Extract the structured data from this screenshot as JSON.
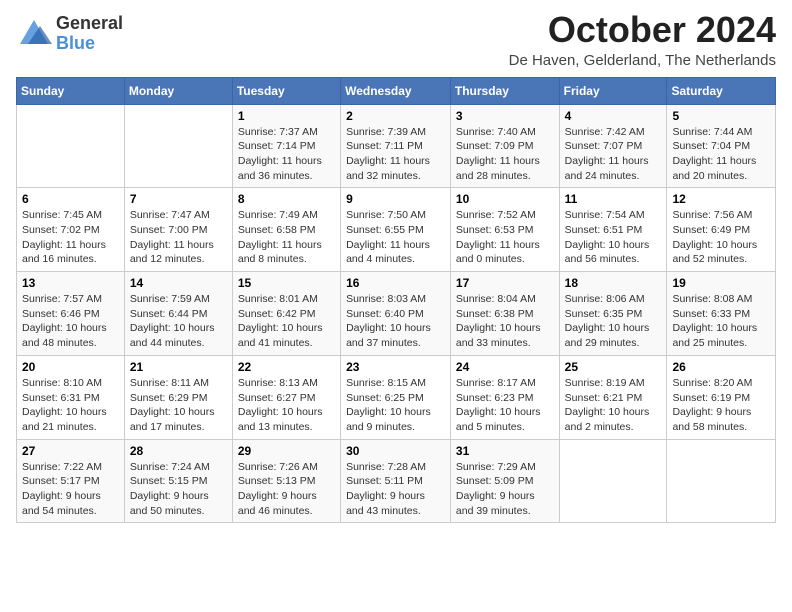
{
  "header": {
    "logo_line1": "General",
    "logo_line2": "Blue",
    "month_title": "October 2024",
    "location": "De Haven, Gelderland, The Netherlands"
  },
  "days_of_week": [
    "Sunday",
    "Monday",
    "Tuesday",
    "Wednesday",
    "Thursday",
    "Friday",
    "Saturday"
  ],
  "weeks": [
    [
      {
        "day": "",
        "info": ""
      },
      {
        "day": "",
        "info": ""
      },
      {
        "day": "1",
        "info": "Sunrise: 7:37 AM\nSunset: 7:14 PM\nDaylight: 11 hours and 36 minutes."
      },
      {
        "day": "2",
        "info": "Sunrise: 7:39 AM\nSunset: 7:11 PM\nDaylight: 11 hours and 32 minutes."
      },
      {
        "day": "3",
        "info": "Sunrise: 7:40 AM\nSunset: 7:09 PM\nDaylight: 11 hours and 28 minutes."
      },
      {
        "day": "4",
        "info": "Sunrise: 7:42 AM\nSunset: 7:07 PM\nDaylight: 11 hours and 24 minutes."
      },
      {
        "day": "5",
        "info": "Sunrise: 7:44 AM\nSunset: 7:04 PM\nDaylight: 11 hours and 20 minutes."
      }
    ],
    [
      {
        "day": "6",
        "info": "Sunrise: 7:45 AM\nSunset: 7:02 PM\nDaylight: 11 hours and 16 minutes."
      },
      {
        "day": "7",
        "info": "Sunrise: 7:47 AM\nSunset: 7:00 PM\nDaylight: 11 hours and 12 minutes."
      },
      {
        "day": "8",
        "info": "Sunrise: 7:49 AM\nSunset: 6:58 PM\nDaylight: 11 hours and 8 minutes."
      },
      {
        "day": "9",
        "info": "Sunrise: 7:50 AM\nSunset: 6:55 PM\nDaylight: 11 hours and 4 minutes."
      },
      {
        "day": "10",
        "info": "Sunrise: 7:52 AM\nSunset: 6:53 PM\nDaylight: 11 hours and 0 minutes."
      },
      {
        "day": "11",
        "info": "Sunrise: 7:54 AM\nSunset: 6:51 PM\nDaylight: 10 hours and 56 minutes."
      },
      {
        "day": "12",
        "info": "Sunrise: 7:56 AM\nSunset: 6:49 PM\nDaylight: 10 hours and 52 minutes."
      }
    ],
    [
      {
        "day": "13",
        "info": "Sunrise: 7:57 AM\nSunset: 6:46 PM\nDaylight: 10 hours and 48 minutes."
      },
      {
        "day": "14",
        "info": "Sunrise: 7:59 AM\nSunset: 6:44 PM\nDaylight: 10 hours and 44 minutes."
      },
      {
        "day": "15",
        "info": "Sunrise: 8:01 AM\nSunset: 6:42 PM\nDaylight: 10 hours and 41 minutes."
      },
      {
        "day": "16",
        "info": "Sunrise: 8:03 AM\nSunset: 6:40 PM\nDaylight: 10 hours and 37 minutes."
      },
      {
        "day": "17",
        "info": "Sunrise: 8:04 AM\nSunset: 6:38 PM\nDaylight: 10 hours and 33 minutes."
      },
      {
        "day": "18",
        "info": "Sunrise: 8:06 AM\nSunset: 6:35 PM\nDaylight: 10 hours and 29 minutes."
      },
      {
        "day": "19",
        "info": "Sunrise: 8:08 AM\nSunset: 6:33 PM\nDaylight: 10 hours and 25 minutes."
      }
    ],
    [
      {
        "day": "20",
        "info": "Sunrise: 8:10 AM\nSunset: 6:31 PM\nDaylight: 10 hours and 21 minutes."
      },
      {
        "day": "21",
        "info": "Sunrise: 8:11 AM\nSunset: 6:29 PM\nDaylight: 10 hours and 17 minutes."
      },
      {
        "day": "22",
        "info": "Sunrise: 8:13 AM\nSunset: 6:27 PM\nDaylight: 10 hours and 13 minutes."
      },
      {
        "day": "23",
        "info": "Sunrise: 8:15 AM\nSunset: 6:25 PM\nDaylight: 10 hours and 9 minutes."
      },
      {
        "day": "24",
        "info": "Sunrise: 8:17 AM\nSunset: 6:23 PM\nDaylight: 10 hours and 5 minutes."
      },
      {
        "day": "25",
        "info": "Sunrise: 8:19 AM\nSunset: 6:21 PM\nDaylight: 10 hours and 2 minutes."
      },
      {
        "day": "26",
        "info": "Sunrise: 8:20 AM\nSunset: 6:19 PM\nDaylight: 9 hours and 58 minutes."
      }
    ],
    [
      {
        "day": "27",
        "info": "Sunrise: 7:22 AM\nSunset: 5:17 PM\nDaylight: 9 hours and 54 minutes."
      },
      {
        "day": "28",
        "info": "Sunrise: 7:24 AM\nSunset: 5:15 PM\nDaylight: 9 hours and 50 minutes."
      },
      {
        "day": "29",
        "info": "Sunrise: 7:26 AM\nSunset: 5:13 PM\nDaylight: 9 hours and 46 minutes."
      },
      {
        "day": "30",
        "info": "Sunrise: 7:28 AM\nSunset: 5:11 PM\nDaylight: 9 hours and 43 minutes."
      },
      {
        "day": "31",
        "info": "Sunrise: 7:29 AM\nSunset: 5:09 PM\nDaylight: 9 hours and 39 minutes."
      },
      {
        "day": "",
        "info": ""
      },
      {
        "day": "",
        "info": ""
      }
    ]
  ]
}
